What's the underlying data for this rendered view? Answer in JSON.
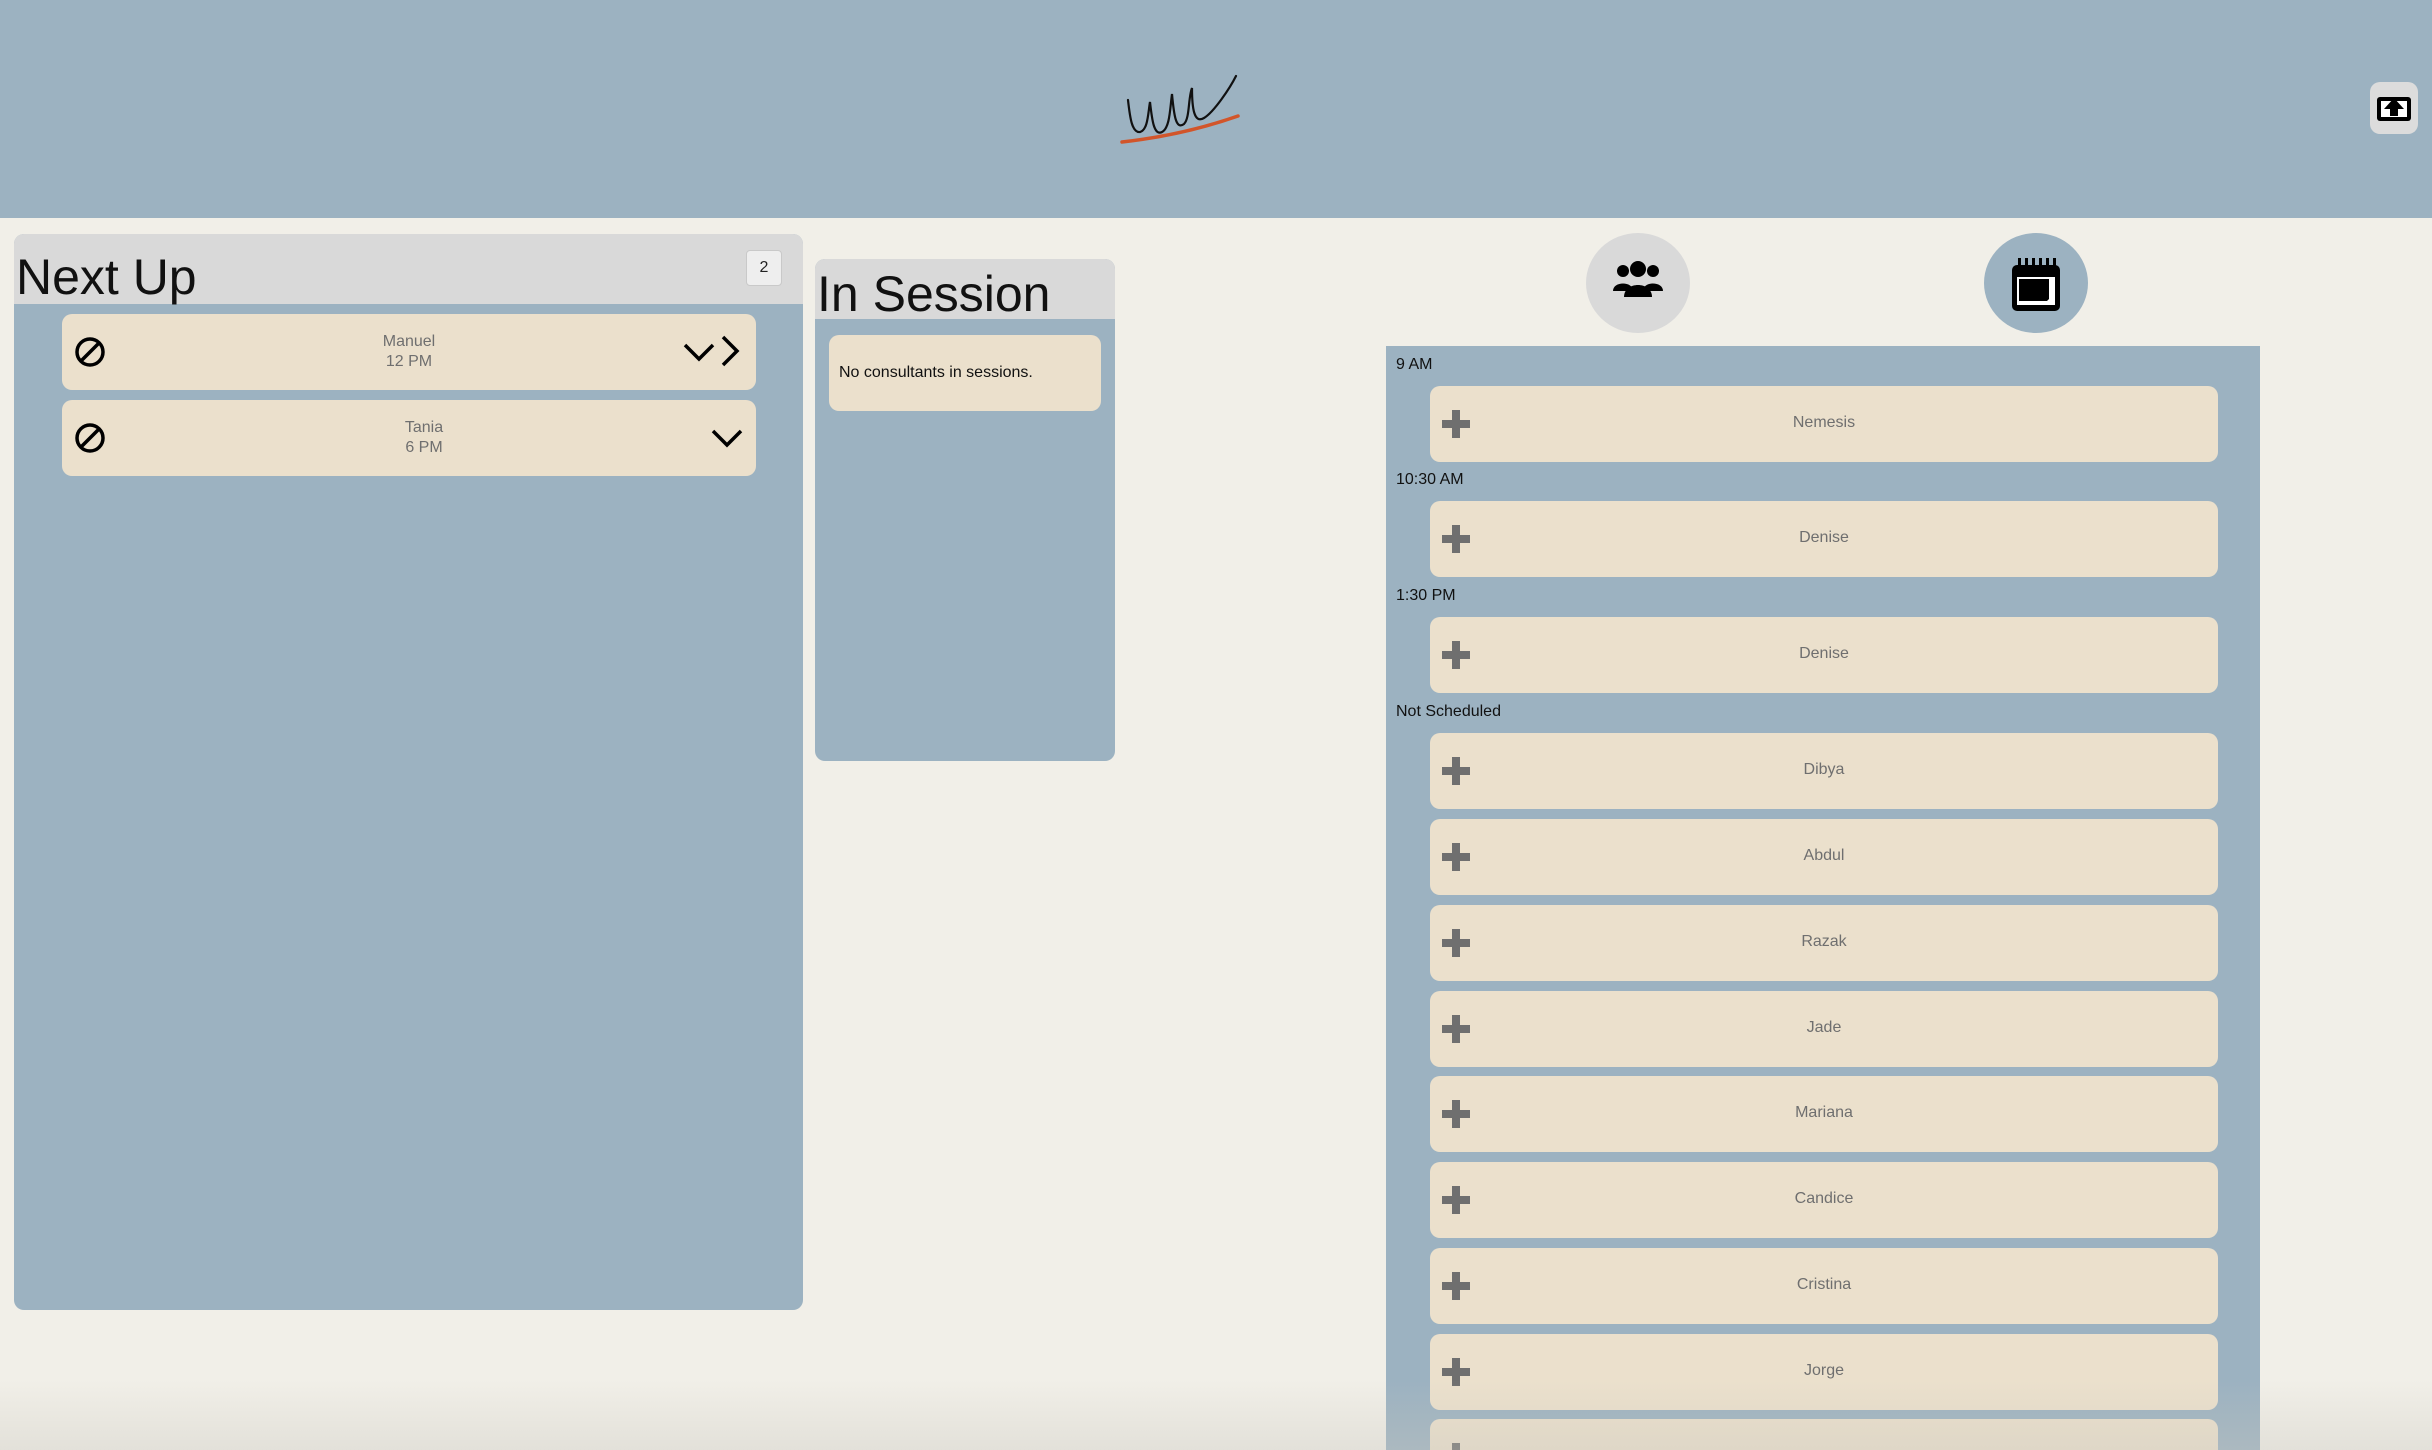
{
  "header": {
    "logo_text": "uwc",
    "logo_icon": "wordmark-logo",
    "exit_icon": "upload-exit-icon"
  },
  "next_up": {
    "title": "Next Up",
    "count": "2",
    "items": [
      {
        "name": "Manuel",
        "time": "12 PM",
        "has_forward": true
      },
      {
        "name": "Tania",
        "time": "6 PM",
        "has_forward": false
      }
    ]
  },
  "in_session": {
    "title": "In Session",
    "empty_message": "No consultants in sessions."
  },
  "view_toggle": {
    "team_icon": "users-icon",
    "calendar_icon": "calendar-icon",
    "active": "calendar"
  },
  "schedule": {
    "groups": [
      {
        "label": "9 AM",
        "consultants": [
          "Nemesis"
        ]
      },
      {
        "label": "10:30 AM",
        "consultants": [
          "Denise"
        ]
      },
      {
        "label": "1:30 PM",
        "consultants": [
          "Denise"
        ]
      },
      {
        "label": "Not Scheduled",
        "consultants": [
          "Dibya",
          "Abdul",
          "Razak",
          "Jade",
          "Mariana",
          "Candice",
          "Cristina",
          "Jorge",
          ""
        ]
      }
    ]
  },
  "colors": {
    "header_bg": "#9cb2c1",
    "page_bg": "#f1efe8",
    "card_bg": "#ebe0cc",
    "panel_head_bg": "#d9d9d9",
    "logo_accent": "#d2552a"
  }
}
